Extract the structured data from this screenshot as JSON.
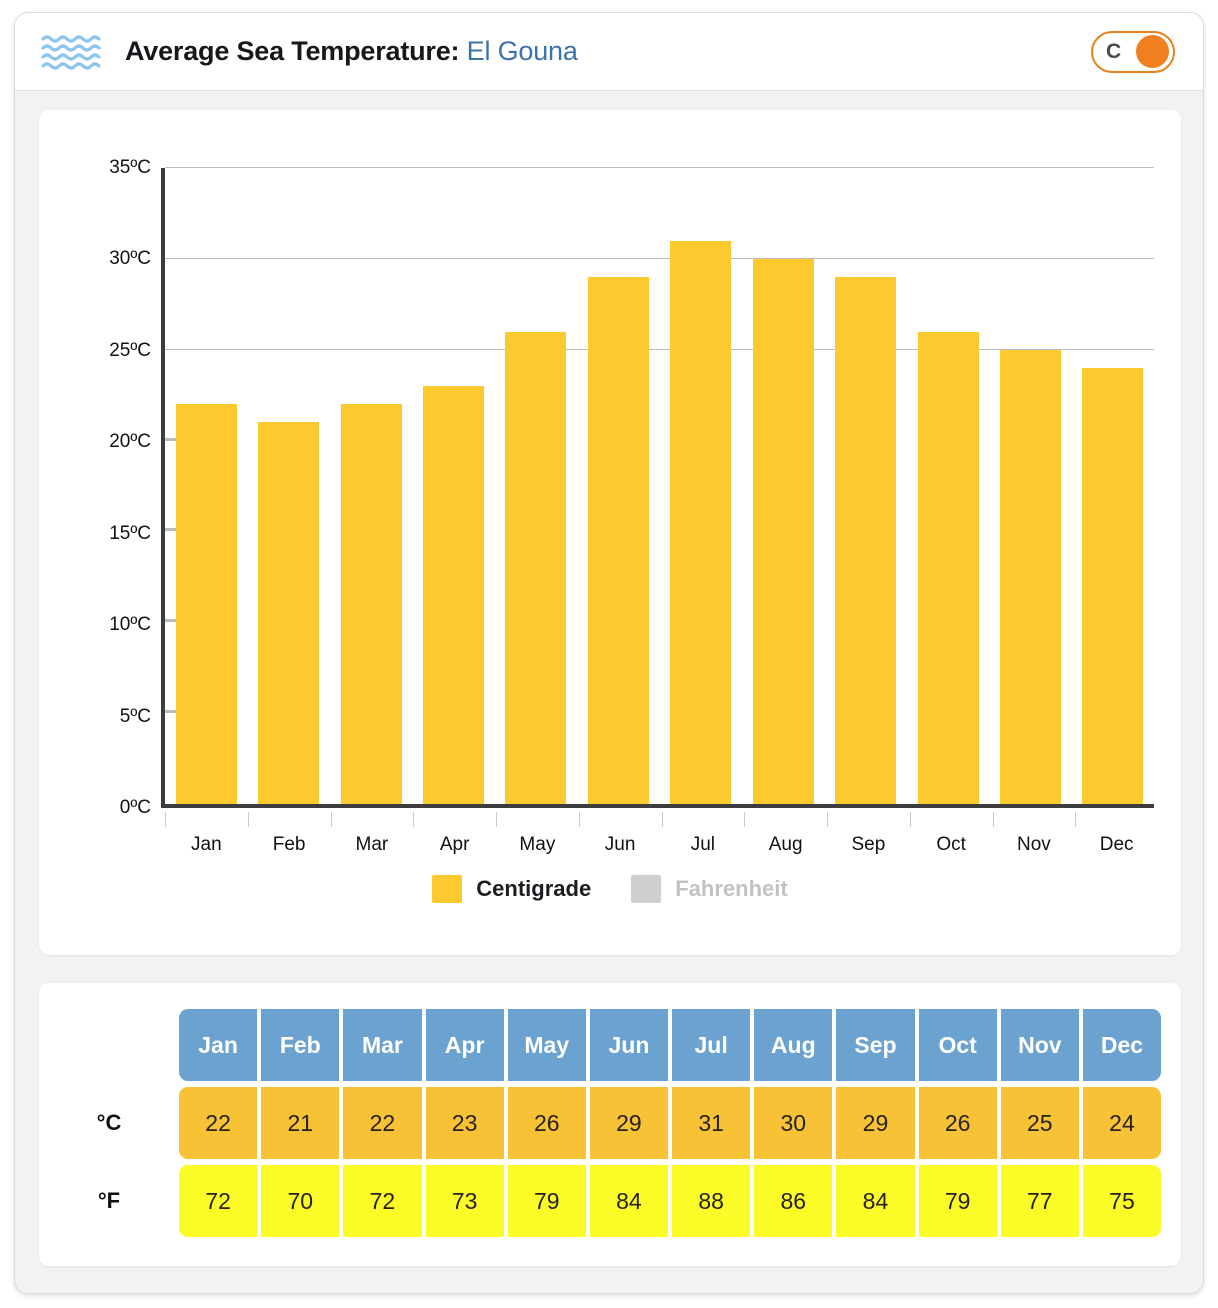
{
  "header": {
    "icon": "sea-waves-icon",
    "title_prefix": "Average Sea Temperature:",
    "location": "El Gouna",
    "unit_toggle": {
      "label": "C",
      "state": "celsius",
      "accent_color": "#ef7f1f"
    }
  },
  "legend": {
    "items": [
      {
        "label": "Centigrade",
        "color": "#fcc92f",
        "active": true
      },
      {
        "label": "Fahrenheit",
        "color": "#cfcfcf",
        "active": false
      }
    ]
  },
  "table": {
    "row_labels": [
      "°C",
      "°F"
    ],
    "months": [
      "Jan",
      "Feb",
      "Mar",
      "Apr",
      "May",
      "Jun",
      "Jul",
      "Aug",
      "Sep",
      "Oct",
      "Nov",
      "Dec"
    ],
    "celsius": [
      22,
      21,
      22,
      23,
      26,
      29,
      31,
      30,
      29,
      26,
      25,
      24
    ],
    "fahrenheit": [
      72,
      70,
      72,
      73,
      79,
      84,
      88,
      86,
      84,
      79,
      77,
      75
    ],
    "header_color": "#6ba2d0",
    "celsius_color": "#f8c236",
    "fahrenheit_color": "#fbfb28"
  },
  "chart_data": {
    "type": "bar",
    "title": "Average Sea Temperature: El Gouna",
    "xlabel": "",
    "ylabel": "",
    "categories": [
      "Jan",
      "Feb",
      "Mar",
      "Apr",
      "May",
      "Jun",
      "Jul",
      "Aug",
      "Sep",
      "Oct",
      "Nov",
      "Dec"
    ],
    "values": [
      22,
      21,
      22,
      23,
      26,
      29,
      31,
      30,
      29,
      26,
      25,
      24
    ],
    "series": [
      {
        "name": "Centigrade",
        "values": [
          22,
          21,
          22,
          23,
          26,
          29,
          31,
          30,
          29,
          26,
          25,
          24
        ],
        "color": "#fcc92f"
      }
    ],
    "ylim": [
      0,
      35
    ],
    "ytick_values": [
      0,
      5,
      10,
      15,
      20,
      25,
      30,
      35
    ],
    "ytick_labels": [
      "0ºC",
      "5ºC",
      "10ºC",
      "15ºC",
      "20ºC",
      "25ºC",
      "30ºC",
      "35ºC"
    ],
    "grid": true,
    "grid_major_at": [
      25,
      30,
      35
    ],
    "legend_position": "bottom",
    "bar_color": "#fcc92f"
  }
}
